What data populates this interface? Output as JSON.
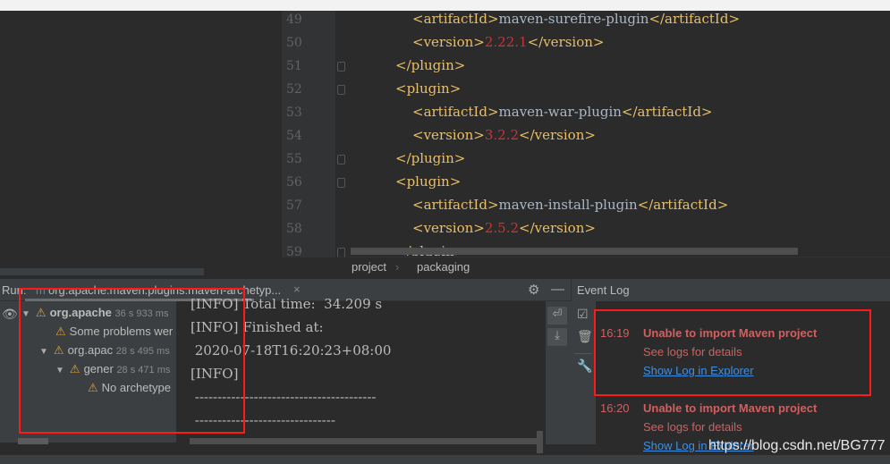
{
  "editor": {
    "lines": [
      {
        "n": "49",
        "indent": 2,
        "tag": "artifactId",
        "value": "maven-surefire-plugin",
        "num": false
      },
      {
        "n": "50",
        "indent": 2,
        "tag": "version",
        "value": "2.22.1",
        "num": true
      },
      {
        "n": "51",
        "indent": 1,
        "close": "</plugin>"
      },
      {
        "n": "52",
        "indent": 1,
        "open": "<plugin>"
      },
      {
        "n": "53",
        "indent": 2,
        "tag": "artifactId",
        "value": "maven-war-plugin",
        "num": false
      },
      {
        "n": "54",
        "indent": 2,
        "tag": "version",
        "value": "3.2.2",
        "num": true
      },
      {
        "n": "55",
        "indent": 1,
        "close": "</plugin>"
      },
      {
        "n": "56",
        "indent": 1,
        "open": "<plugin>"
      },
      {
        "n": "57",
        "indent": 2,
        "tag": "artifactId",
        "value": "maven-install-plugin",
        "num": false
      },
      {
        "n": "58",
        "indent": 2,
        "tag": "version",
        "value": "2.5.2",
        "num": true
      },
      {
        "n": "59",
        "indent": 1,
        "close": "</plugin>"
      }
    ],
    "breadcrumb": [
      "project",
      "packaging"
    ]
  },
  "run": {
    "label": "Run:",
    "tab_title": "org.apache.maven.plugins:maven-archetyp...",
    "tree": [
      {
        "label": "org.apache",
        "time": "36 s 933 ms",
        "bold": true,
        "tri": true
      },
      {
        "label": "Some problems wer",
        "time": "",
        "tri": false
      },
      {
        "label": "org.apac",
        "time": "28 s 495 ms",
        "tri": true
      },
      {
        "label": "gener",
        "time": "28 s 471 ms",
        "tri": true
      },
      {
        "label": "No archetype",
        "time": "",
        "tri": false
      }
    ],
    "console": [
      "[INFO] Total time:  34.209 s",
      "[INFO] Finished at:",
      " 2020-07-18T16:20:23+08:00",
      "[INFO]",
      " ----------------------------------------",
      " -------------------------------"
    ]
  },
  "event_log": {
    "title": "Event Log",
    "events": [
      {
        "time": "16:19",
        "title": "Unable to import Maven project",
        "detail": "See logs for details",
        "link": "Show Log in Explorer"
      },
      {
        "time": "16:20",
        "title": "Unable to import Maven project",
        "detail": "See logs for details",
        "link": "Show Log in Explorer"
      }
    ]
  },
  "watermark": "https://blog.csdn.net/BG777",
  "colors": {
    "highlight_box": "#ff1a1a",
    "error": "#d06060",
    "link": "#3d8fe6",
    "warning": "#e0a030"
  }
}
